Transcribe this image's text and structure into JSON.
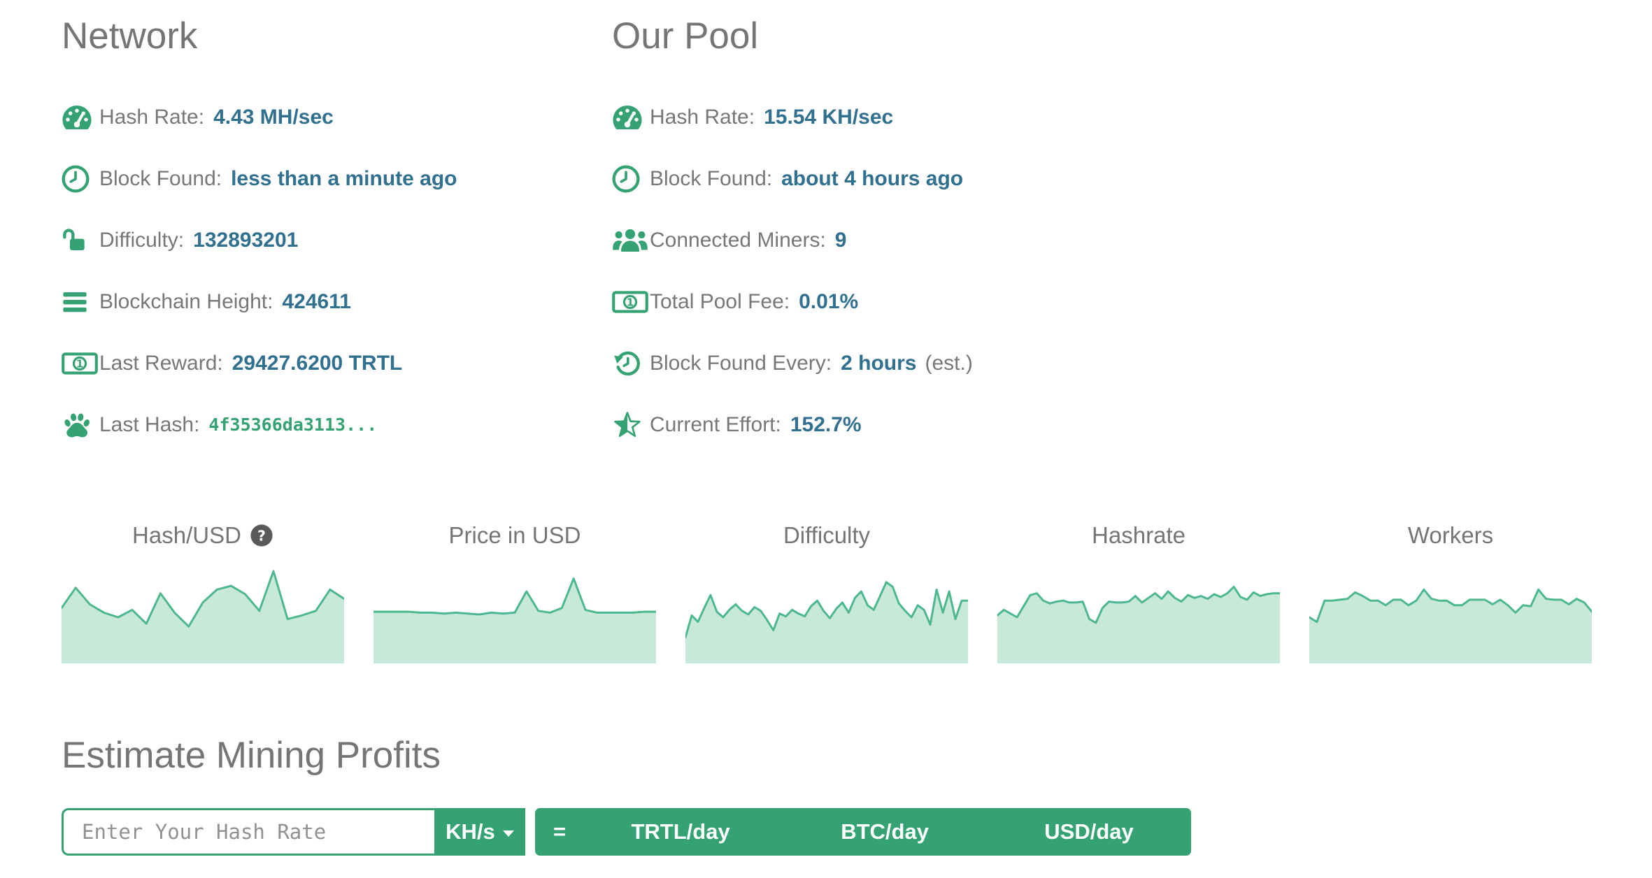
{
  "network": {
    "title": "Network",
    "stats": [
      {
        "icon": "tachometer-icon",
        "label": "Hash Rate:",
        "value": "4.43 MH/sec"
      },
      {
        "icon": "clock-icon",
        "label": "Block Found:",
        "value": "less than a minute ago"
      },
      {
        "icon": "unlock-icon",
        "label": "Difficulty:",
        "value": "132893201"
      },
      {
        "icon": "bars-icon",
        "label": "Blockchain Height:",
        "value": "424611"
      },
      {
        "icon": "money-icon",
        "label": "Last Reward:",
        "value": "29427.6200 TRTL"
      },
      {
        "icon": "paw-icon",
        "label": "Last Hash:",
        "value": "4f35366da3113...",
        "mono": true
      }
    ]
  },
  "pool": {
    "title": "Our Pool",
    "stats": [
      {
        "icon": "tachometer-icon",
        "label": "Hash Rate:",
        "value": "15.54 KH/sec"
      },
      {
        "icon": "clock-icon",
        "label": "Block Found:",
        "value": "about 4 hours ago"
      },
      {
        "icon": "users-icon",
        "label": "Connected Miners:",
        "value": "9"
      },
      {
        "icon": "money-icon",
        "label": "Total Pool Fee:",
        "value": "0.01%"
      },
      {
        "icon": "history-icon",
        "label": "Block Found Every:",
        "value": "2 hours",
        "suffix": "(est.)"
      },
      {
        "icon": "star-half-icon",
        "label": "Current Effort:",
        "value": "152.7%"
      }
    ]
  },
  "chart_data": [
    {
      "type": "area",
      "title": "Hash/USD",
      "has_help_icon": true,
      "x": "time (unlabeled sparkline)",
      "ylim": [
        0,
        100
      ],
      "grid": false,
      "legend": false,
      "values": [
        60,
        82,
        64,
        55,
        50,
        58,
        43,
        76,
        55,
        40,
        66,
        80,
        84,
        75,
        57,
        100,
        48,
        52,
        57,
        80,
        70
      ]
    },
    {
      "type": "area",
      "title": "Price in USD",
      "has_help_icon": false,
      "x": "time (unlabeled sparkline)",
      "ylim": [
        0,
        100
      ],
      "grid": false,
      "legend": false,
      "values": [
        56,
        56,
        56,
        56,
        55,
        55,
        54,
        55,
        54,
        53,
        55,
        54,
        55,
        78,
        57,
        55,
        60,
        92,
        58,
        55,
        55,
        55,
        55,
        56,
        56
      ]
    },
    {
      "type": "area",
      "title": "Difficulty",
      "has_help_icon": false,
      "x": "time (unlabeled sparkline)",
      "ylim": [
        0,
        100
      ],
      "grid": false,
      "legend": false,
      "values": [
        28,
        52,
        45,
        60,
        74,
        56,
        50,
        58,
        64,
        57,
        53,
        61,
        57,
        47,
        36,
        54,
        51,
        58,
        54,
        51,
        62,
        68,
        57,
        49,
        59,
        66,
        55,
        71,
        78,
        63,
        58,
        73,
        88,
        83,
        65,
        57,
        50,
        63,
        58,
        42,
        80,
        55,
        78,
        48,
        68,
        68
      ]
    },
    {
      "type": "area",
      "title": "Hashrate",
      "has_help_icon": false,
      "x": "time (unlabeled sparkline)",
      "ylim": [
        0,
        100
      ],
      "grid": false,
      "legend": false,
      "values": [
        52,
        58,
        54,
        50,
        62,
        74,
        76,
        68,
        65,
        67,
        68,
        66,
        66,
        67,
        48,
        44,
        60,
        67,
        66,
        66,
        67,
        73,
        66,
        71,
        76,
        70,
        78,
        71,
        67,
        74,
        71,
        73,
        70,
        75,
        72,
        76,
        83,
        72,
        69,
        77,
        73,
        75,
        76,
        76
      ]
    },
    {
      "type": "area",
      "title": "Workers",
      "has_help_icon": false,
      "x": "time (unlabeled sparkline)",
      "ylim": [
        0,
        100
      ],
      "grid": false,
      "legend": false,
      "values": [
        50,
        45,
        68,
        68,
        69,
        70,
        77,
        73,
        68,
        68,
        63,
        69,
        69,
        63,
        68,
        80,
        70,
        68,
        68,
        63,
        63,
        69,
        69,
        69,
        64,
        69,
        63,
        55,
        63,
        62,
        80,
        70,
        69,
        69,
        64,
        70,
        66,
        56
      ]
    }
  ],
  "estimate": {
    "title": "Estimate Mining Profits",
    "input_placeholder": "Enter Your Hash Rate",
    "unit_label": "KH/s",
    "equals": "=",
    "result_labels": [
      "TRTL/day",
      "BTC/day",
      "USD/day"
    ]
  },
  "colors": {
    "accent_green": "#35a273",
    "value_text": "#31708f",
    "label_text": "#777777",
    "heading_text": "#757575",
    "chart_line": "#4db890",
    "chart_fill": "#c8e8d9",
    "help_circle": "#595959",
    "mono_hash_text": "#35a273"
  }
}
